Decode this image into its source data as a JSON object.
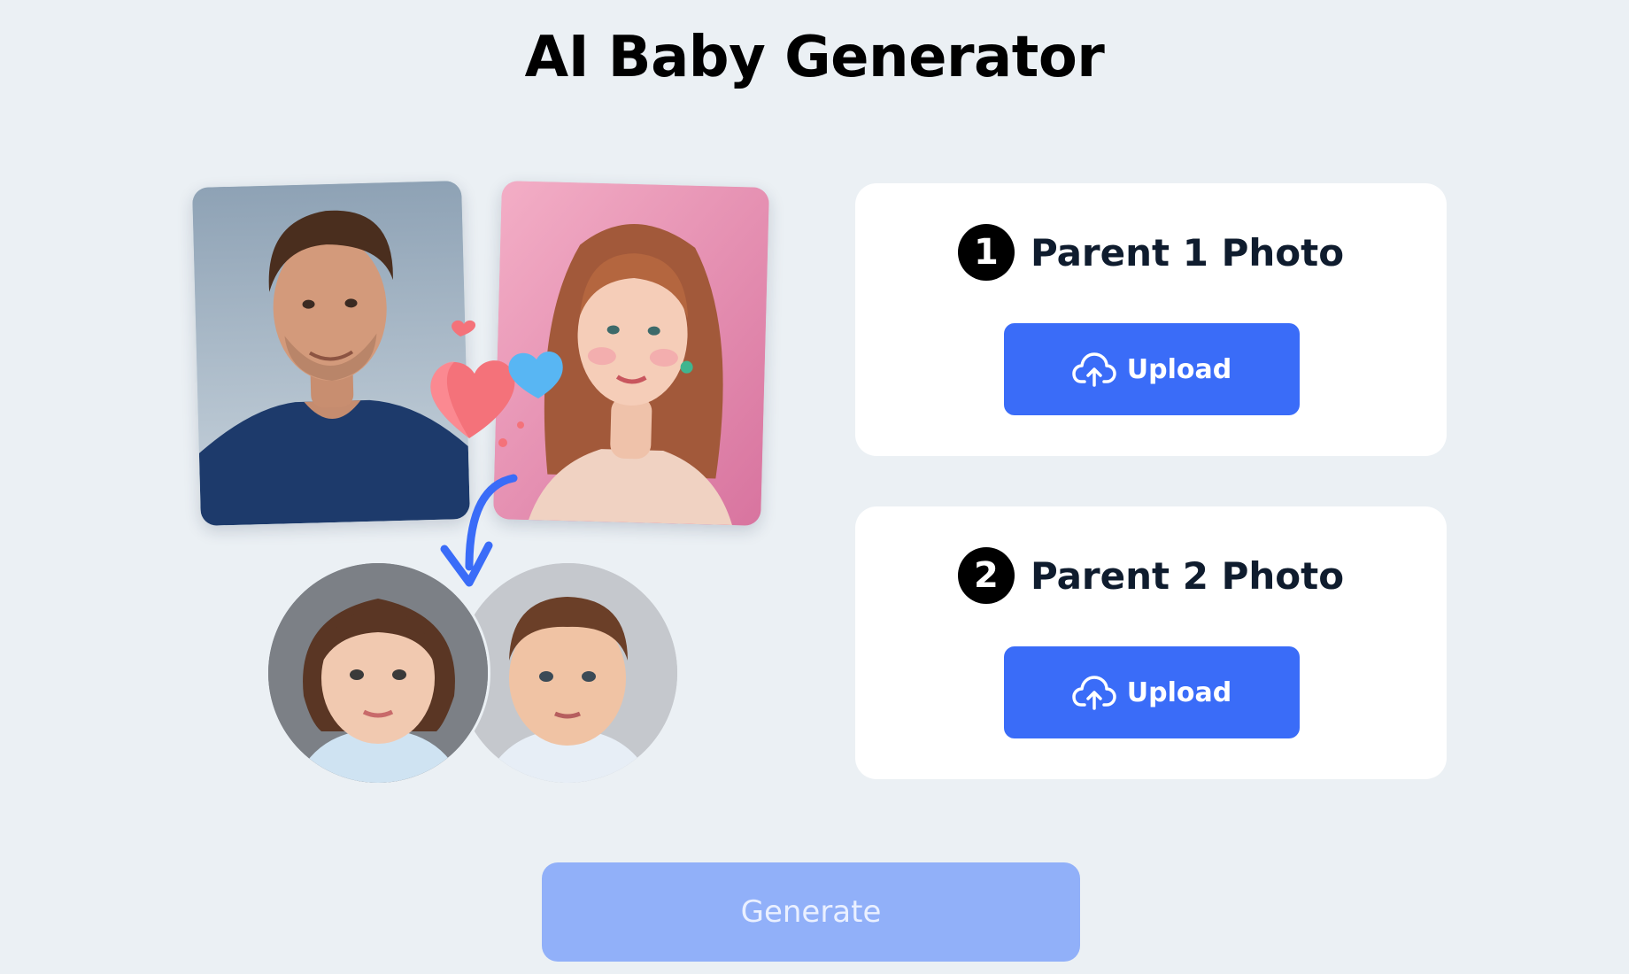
{
  "page": {
    "title": "AI Baby Generator"
  },
  "illustration": {
    "parent_photos": [
      "man-portrait",
      "woman-portrait"
    ],
    "child_photos": [
      "girl-portrait",
      "boy-portrait"
    ],
    "decor_icons": [
      "heart-icon",
      "down-arrow-icon"
    ]
  },
  "cards": [
    {
      "step": "1",
      "title": "Parent 1 Photo",
      "button_label": "Upload",
      "button_icon": "cloud-upload-icon"
    },
    {
      "step": "2",
      "title": "Parent 2 Photo",
      "button_label": "Upload",
      "button_icon": "cloud-upload-icon"
    }
  ],
  "generate": {
    "label": "Generate",
    "state": "disabled"
  },
  "colors": {
    "background": "#ebf0f4",
    "primary_button": "#3a6cf8",
    "generate_disabled": "#91b0f9",
    "card": "#ffffff",
    "step_badge": "#000000"
  }
}
